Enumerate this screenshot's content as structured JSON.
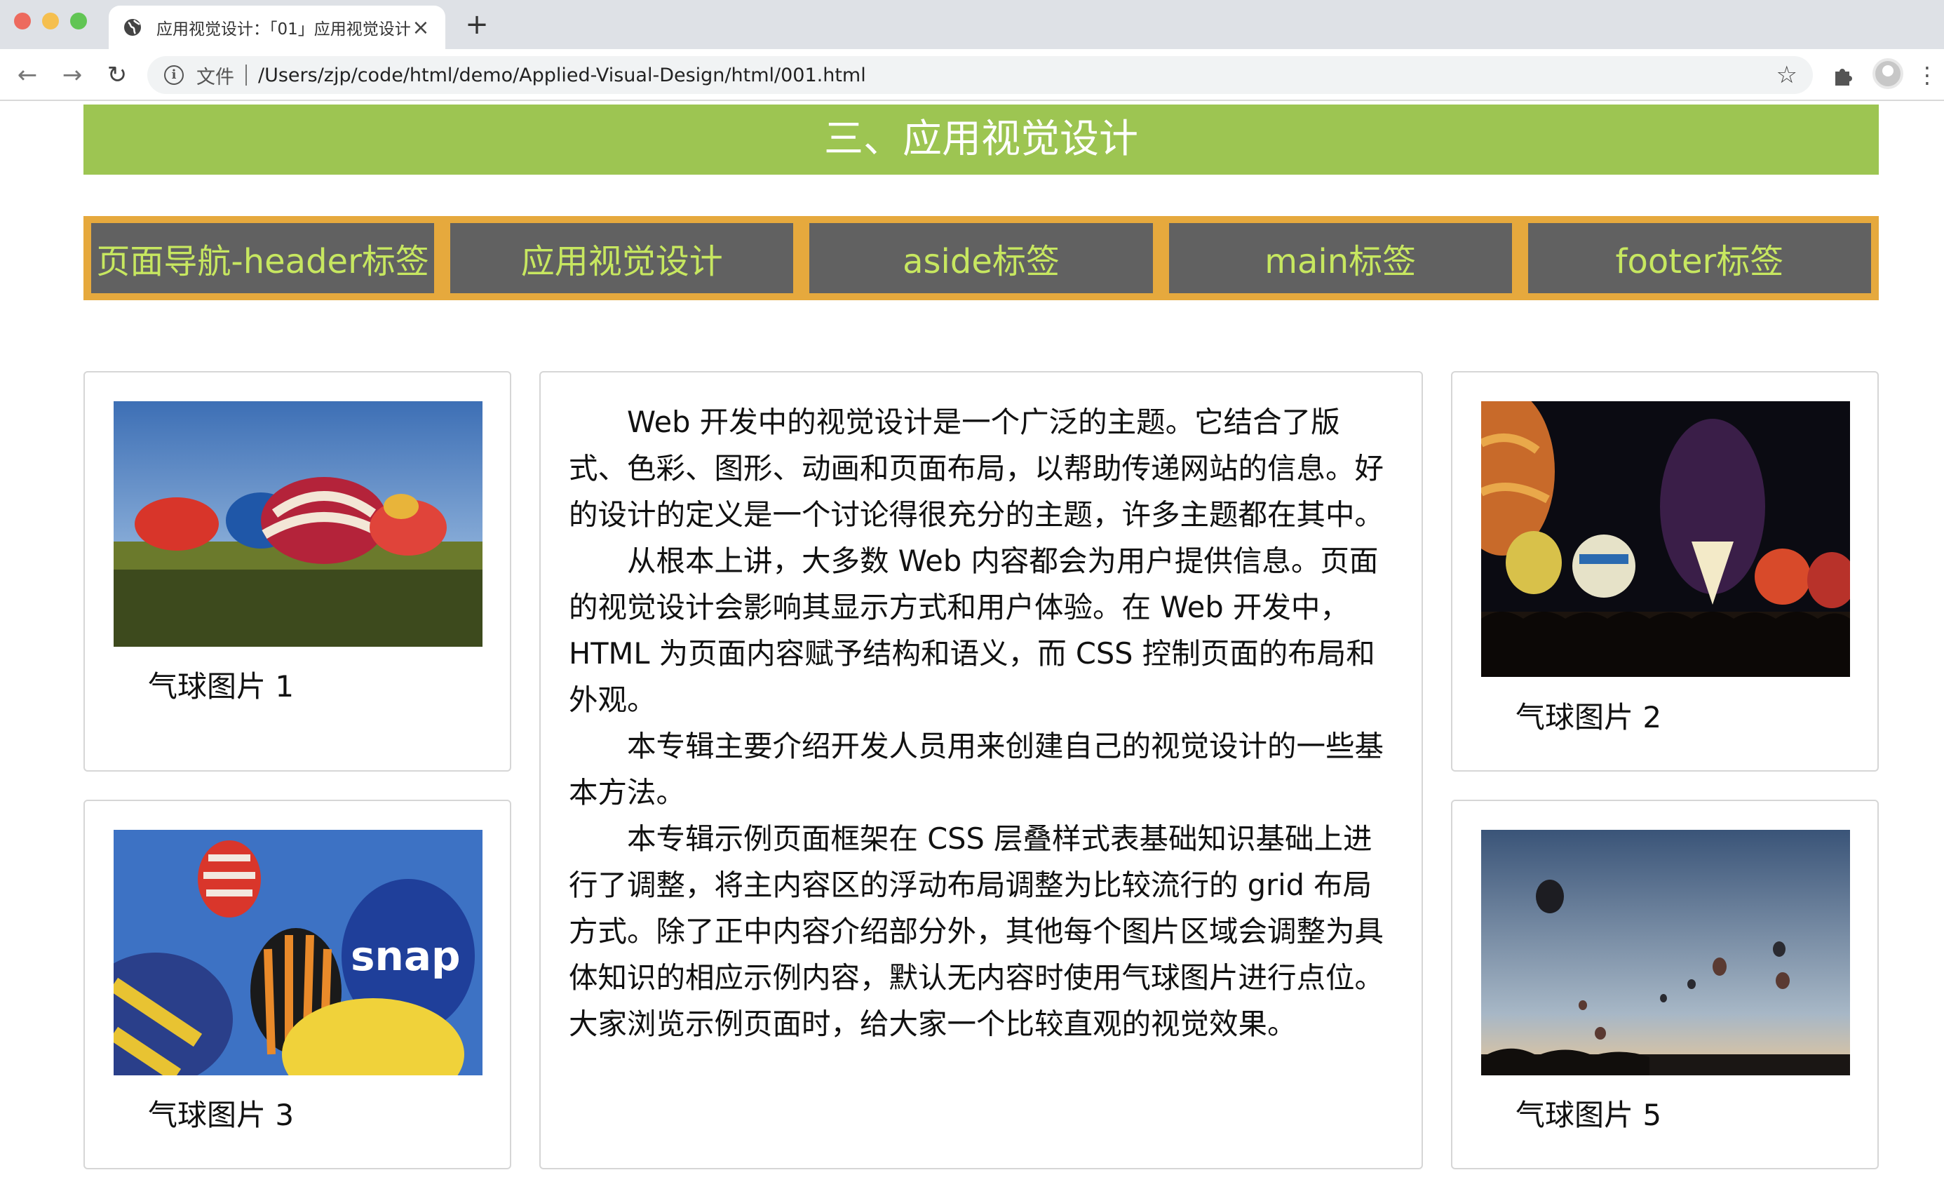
{
  "browser": {
    "tab_title": "应用视觉设计：「01」应用视觉设计",
    "secure_label": "文件",
    "url": "/Users/zjp/code/html/demo/Applied-Visual-Design/html/001.html"
  },
  "page": {
    "header_title": "三、应用视觉设计",
    "nav": [
      {
        "label": "页面导航-header标签"
      },
      {
        "label": "应用视觉设计"
      },
      {
        "label": "aside标签"
      },
      {
        "label": "main标签"
      },
      {
        "label": "footer标签"
      }
    ],
    "left_cards": [
      {
        "caption": "气球图片 1"
      },
      {
        "caption": "气球图片 3"
      }
    ],
    "right_cards": [
      {
        "caption": "气球图片 2"
      },
      {
        "caption": "气球图片 5"
      }
    ],
    "article": {
      "paragraphs": [
        "Web 开发中的视觉设计是一个广泛的主题。它结合了版式、色彩、图形、动画和页面布局，以帮助传递网站的信息。好的设计的定义是一个讨论得很充分的主题，许多主题都在其中。",
        "从根本上讲，大多数 Web 内容都会为用户提供信息。页面的视觉设计会影响其显示方式和用户体验。在 Web 开发中，HTML 为页面内容赋予结构和语义，而 CSS 控制页面的布局和外观。",
        "本专辑主要介绍开发人员用来创建自己的视觉设计的一些基本方法。",
        "本专辑示例页面框架在 CSS 层叠样式表基础知识基础上进行了调整，将主内容区的浮动布局调整为比较流行的 grid 布局方式。除了正中内容介绍部分外，其他每个图片区域会调整为具体知识的相应示例内容，默认无内容时使用气球图片进行点位。大家浏览示例页面时，给大家一个比较直观的视觉效果。"
      ]
    }
  },
  "colors": {
    "header_bg": "#9dc552",
    "nav_border": "#e6a93d",
    "nav_item_bg": "#616161",
    "nav_text": "#c7e760"
  }
}
